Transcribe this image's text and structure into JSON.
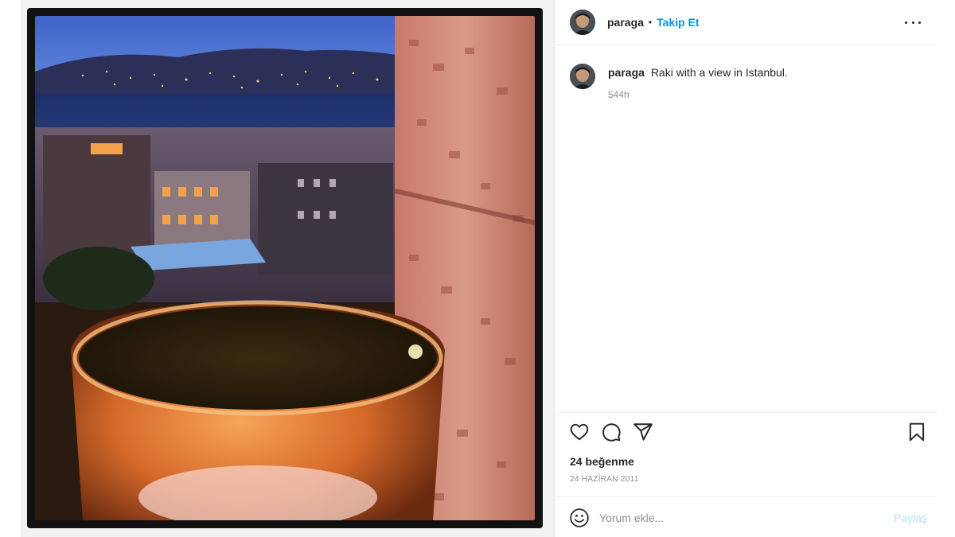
{
  "post": {
    "username": "paraga",
    "separator": "•",
    "follow_label": "Takip Et",
    "caption": "Raki with a view in Istanbul.",
    "time_ago": "544h",
    "likes": "24 beğenme",
    "date": "24 HAZİRAN 2011"
  },
  "comment": {
    "placeholder": "Yorum ekle...",
    "post_label": "Paylaş"
  },
  "icons": {
    "more": "more-options-icon",
    "like": "heart-icon",
    "comment": "comment-bubble-icon",
    "share": "paper-plane-icon",
    "save": "bookmark-icon",
    "emoji": "smiley-icon"
  },
  "colors": {
    "accent": "#0095f6",
    "post_disabled": "#b2dffc",
    "muted": "#8e8e8e",
    "text": "#262626"
  }
}
